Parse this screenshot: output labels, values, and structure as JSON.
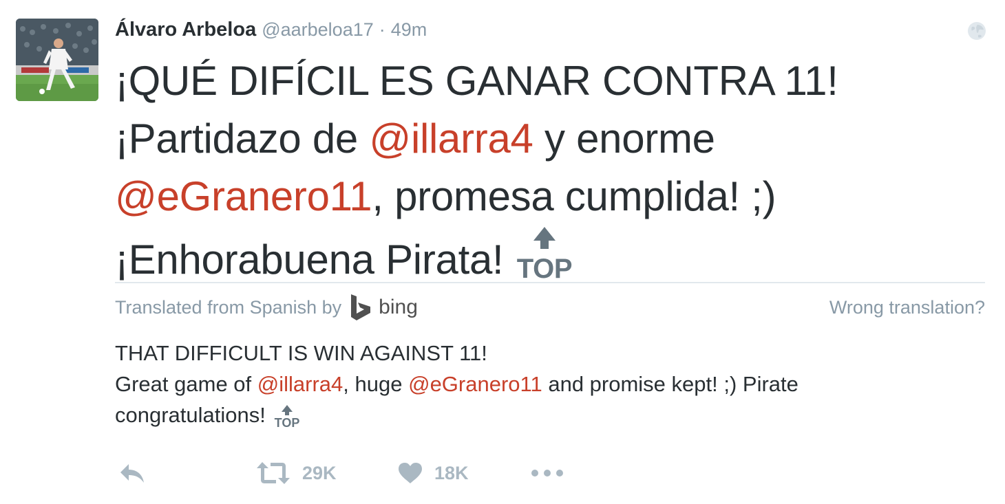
{
  "tweet": {
    "author_name": "Álvaro Arbeloa",
    "handle": "@aarbeloa17",
    "separator": "·",
    "time": "49m",
    "text": {
      "line1": "¡QUÉ DIFÍCIL ES GANAR CONTRA 11!",
      "line2_prefix": "¡Partidazo de ",
      "line2_mention": "@illarra4",
      "line2_suffix": " y enorme",
      "line3_mention": "@eGranero11",
      "line3_suffix": ", promesa cumplida! ;)",
      "line4": "¡Enhorabuena Pirata!",
      "emoji_label": "TOP"
    }
  },
  "translation": {
    "translated_from": "Translated from Spanish by",
    "provider": "bing",
    "wrong_translation": "Wrong translation?",
    "line1": "THAT DIFFICULT IS WIN AGAINST 11!",
    "line2_prefix": "Great game of ",
    "line2_mention1": "@illarra4",
    "line2_middle": ", huge ",
    "line2_mention2": "@eGranero11",
    "line2_suffix": " and promise kept! ;) Pirate",
    "line3": "congratulations!",
    "emoji_label": "TOP"
  },
  "actions": {
    "retweet_count": "29K",
    "like_count": "18K"
  },
  "colors": {
    "mention": "#c8402a",
    "muted": "#8899a6",
    "text": "#292f33",
    "action_icon": "#aab8c2"
  },
  "icons": {
    "globe": "globe-icon",
    "reply": "reply-icon",
    "retweet": "retweet-icon",
    "like": "heart-icon",
    "more": "more-dots-icon",
    "bing": "bing-logo-icon",
    "top_emoji": "top-arrow-emoji"
  }
}
